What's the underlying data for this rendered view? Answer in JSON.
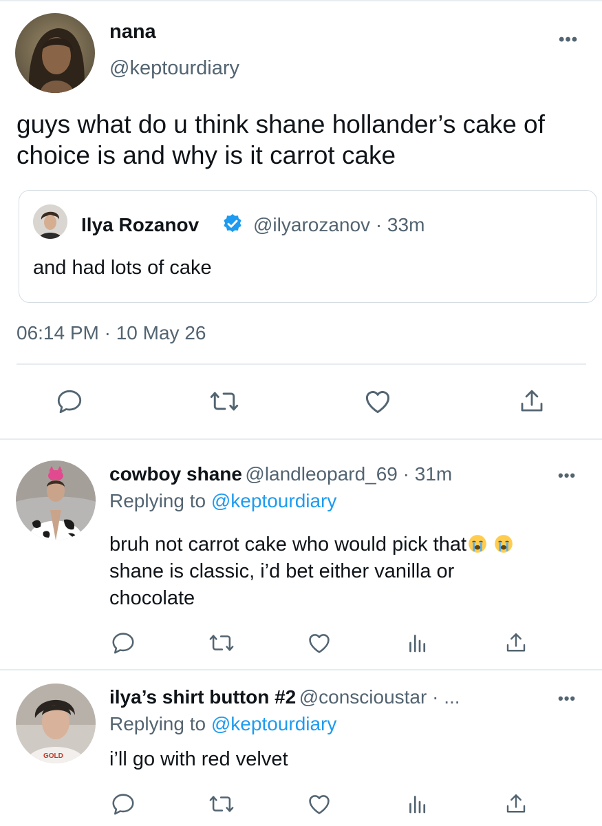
{
  "main_tweet": {
    "author_name": "nana",
    "author_handle": "@keptourdiary",
    "more_label": "•••",
    "text": "guys what do u think shane hollander’s cake of choice is and why is it carrot cake",
    "quote": {
      "author_name": "Ilya Rozanov",
      "author_handle": "@ilyarozanov · 33m",
      "text": "and had lots of cake"
    },
    "timestamp": "06:14 PM · 10 May 26"
  },
  "replies": [
    {
      "author_name": "cowboy shane",
      "meta": "@landleopard_69 · 31m",
      "replying_prefix": "Replying to ",
      "replying_to": "@keptourdiary",
      "text_line1": "bruh not carrot cake who would pick that",
      "text_line2": "shane is classic, i’d bet either vanilla or",
      "text_line3": "chocolate",
      "emoji": "loudly-crying-face-emoji"
    },
    {
      "author_name": "ilya’s shirt button #2",
      "meta": "@conscioustar · ...",
      "replying_prefix": "Replying to ",
      "replying_to": "@keptourdiary",
      "text_line1": "i’ll go with red velvet"
    }
  ],
  "icons": [
    "reply-icon",
    "retweet-icon",
    "like-icon",
    "views-icon",
    "share-icon",
    "verified-badge-icon",
    "more-icon"
  ],
  "colors": {
    "link": "#1d9bf0",
    "secondary_text": "#536471",
    "divider": "#e6ecf0",
    "verified": "#1d9bf0"
  }
}
